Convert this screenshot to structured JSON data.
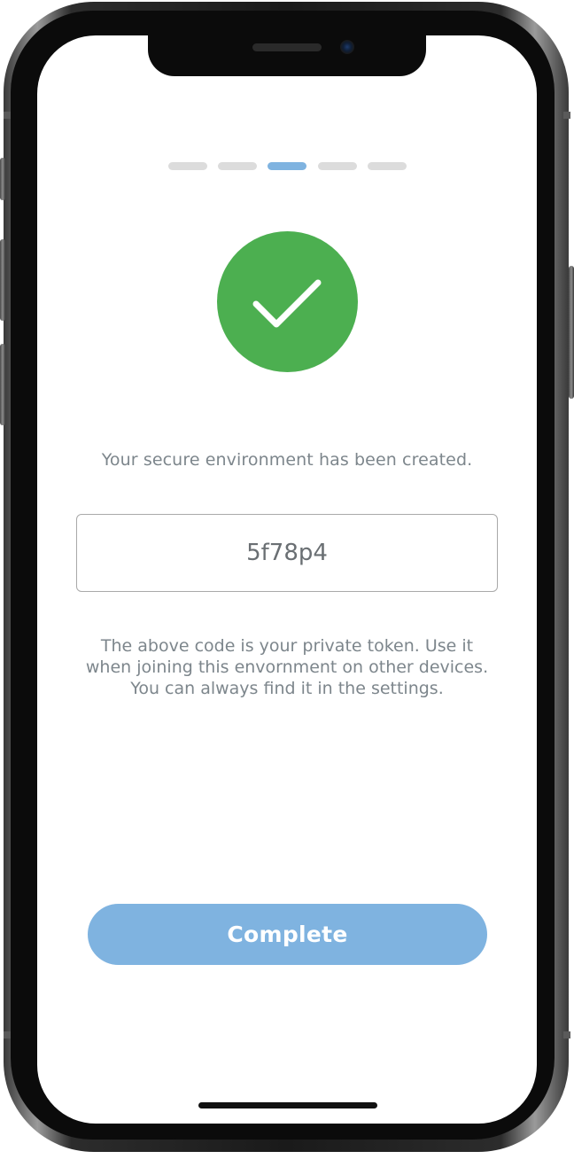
{
  "onboarding": {
    "progress": {
      "total_steps": 5,
      "current_step": 3
    },
    "status_icon": "checkmark-icon",
    "message": "Your secure environment has been created.",
    "token_value": "5f78p4",
    "help_lines": [
      "The above code is your private token. Use it",
      "when joining this envornment on other devices.",
      "You can always find it in the settings."
    ],
    "complete_label": "Complete"
  },
  "colors": {
    "accent": "#7fb3e0",
    "success": "#4caf50",
    "text_muted": "#7d868c",
    "inactive_step": "#dcdcdc"
  }
}
